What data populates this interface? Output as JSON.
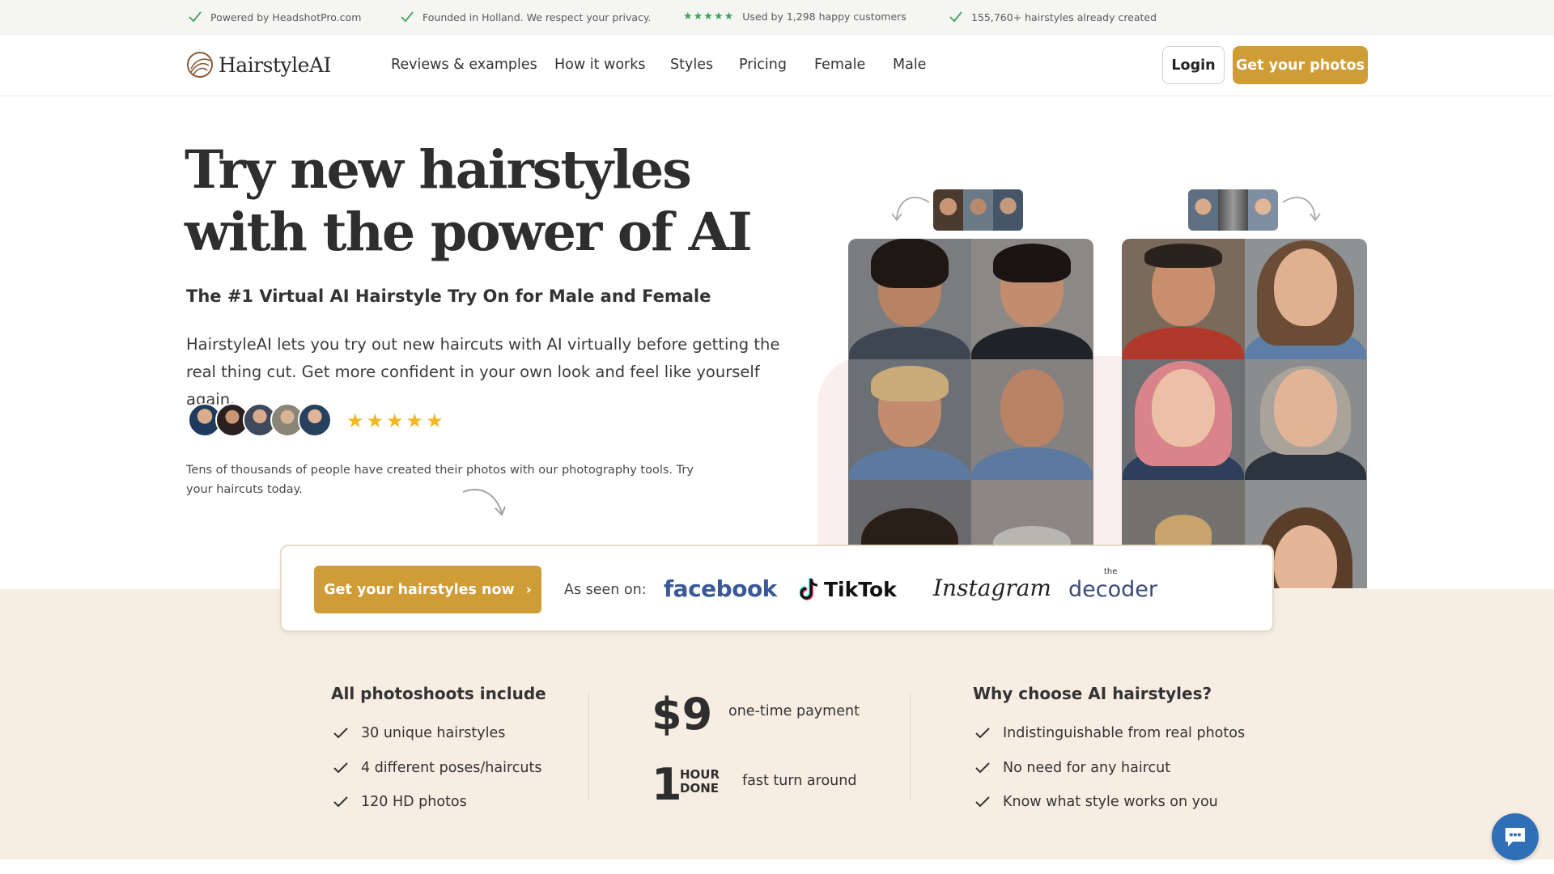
{
  "topbar": {
    "items": [
      {
        "label": "Powered by HeadshotPro.com"
      },
      {
        "label": "Founded in Holland. We respect your privacy."
      },
      {
        "label": "Used by 1,298 happy customers",
        "stars": "★★★★★"
      },
      {
        "label": "155,760+ hairstyles already created"
      }
    ]
  },
  "nav": {
    "logo_text": "HairstyleAI",
    "links": [
      "Reviews & examples",
      "How it works",
      "Styles",
      "Pricing",
      "Female",
      "Male"
    ],
    "login_label": "Login",
    "cta_label": "Get your photos"
  },
  "hero": {
    "title_line1": "Try new hairstyles",
    "title_line2": "with the power of AI",
    "subtitle": "The #1 Virtual AI Hairstyle Try On for Male and Female",
    "description": "HairstyleAI lets you try out new haircuts with AI virtually before getting the real thing cut. Get more confident in your own look and feel like yourself again.",
    "rating": 5,
    "stars": "★★★★★",
    "note": "Tens of thousands of people have created their photos with our photography tools. Try your haircuts today."
  },
  "seen_on": {
    "cta_label": "Get your hairstyles now",
    "chevron": "›",
    "label": "As seen on:",
    "brands": {
      "facebook": "facebook",
      "tiktok": "TikTok",
      "instagram": "Instagram",
      "decoder_small": "the",
      "decoder": "decoder"
    }
  },
  "features": {
    "left_title": "All photoshoots include",
    "left_items": [
      "30 unique hairstyles",
      "4 different poses/haircuts",
      "120 HD photos"
    ],
    "price": "$9",
    "price_text": "one-time payment",
    "hour_number": "1",
    "hour_label_1": "HOUR",
    "hour_label_2": "DONE",
    "hour_text": "fast turn around",
    "right_title": "Why choose AI hairstyles?",
    "right_items": [
      "Indistinguishable from real photos",
      "No need for any haircut",
      "Know what style works on you"
    ]
  },
  "colors": {
    "accent": "#cf9c35",
    "star_gold": "#f2b824",
    "check_green": "#3aa65a",
    "band_beige": "#f7ede3",
    "chat_blue": "#2f6fb8"
  },
  "icons": [
    "check-icon",
    "star-icon",
    "logo-icon",
    "chevron-right-icon",
    "curved-arrow-icon",
    "chat-icon",
    "tiktok-icon"
  ]
}
